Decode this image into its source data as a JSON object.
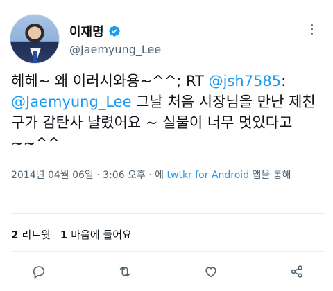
{
  "author": {
    "display_name": "이재명",
    "handle": "@Jaemyung_Lee"
  },
  "tweet": {
    "line1_text": "헤헤~ 왜 이러시와용~^^;  RT ",
    "line1_mention": "@jsh7585",
    "line1_colon": ":",
    "mention2": "@Jaemyung_Lee",
    "body": " 그날 처음 시장님을 만난 제친구가 감탄사 날렸어요 ~ 실물이 너무 멋있다고~~^^"
  },
  "meta": {
    "date": "2014년 04월 06일",
    "sep": " · ",
    "time": "3:06 오후",
    "via_prefix": " · 에 ",
    "app": "twtkr for Android",
    "via_suffix": " 앱을 통해"
  },
  "stats": {
    "retweets_count": "2",
    "retweets_label": "리트윗",
    "likes_count": "1",
    "likes_label": "마음에 들어요"
  },
  "icons": {
    "verified": "verified-badge-icon",
    "more": "more-icon",
    "reply": "reply-icon",
    "retweet": "retweet-icon",
    "like": "like-icon",
    "share": "share-icon"
  },
  "colors": {
    "accent": "#1d9bf0",
    "muted": "#536471",
    "text": "#0f1419"
  }
}
